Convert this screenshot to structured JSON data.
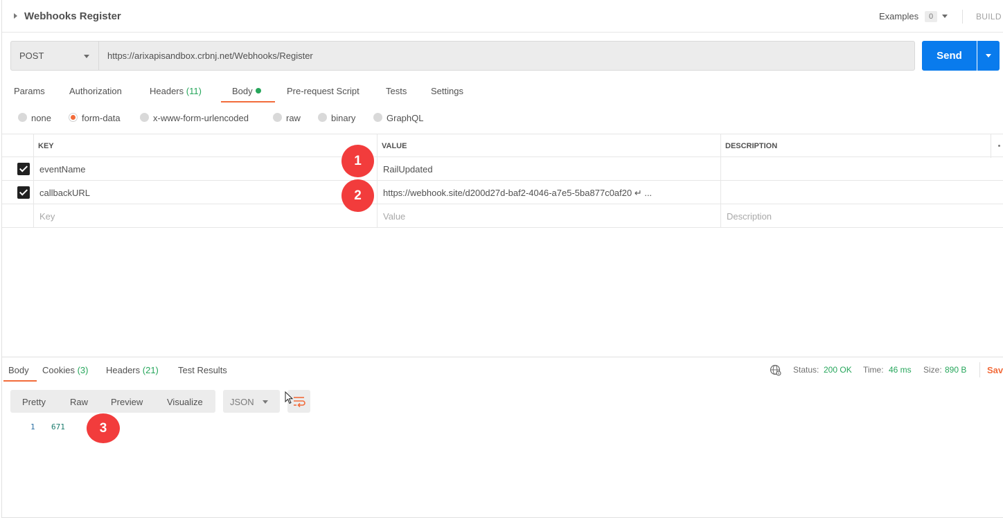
{
  "request": {
    "title": "Webhooks Register",
    "examples_label": "Examples",
    "examples_count": "0",
    "build_label": "BUILD",
    "method": "POST",
    "url": "https://arixapisandbox.crbnj.net/Webhooks/Register",
    "send_label": "Send"
  },
  "request_tabs": [
    {
      "label": "Params"
    },
    {
      "label": "Authorization"
    },
    {
      "label": "Headers",
      "count": "(11)"
    },
    {
      "label": "Body",
      "active": true
    },
    {
      "label": "Pre-request Script"
    },
    {
      "label": "Tests"
    },
    {
      "label": "Settings"
    }
  ],
  "body_types": [
    {
      "label": "none"
    },
    {
      "label": "form-data",
      "selected": true
    },
    {
      "label": "x-www-form-urlencoded"
    },
    {
      "label": "raw"
    },
    {
      "label": "binary"
    },
    {
      "label": "GraphQL"
    }
  ],
  "table": {
    "headers": [
      "KEY",
      "VALUE",
      "DESCRIPTION"
    ],
    "rows": [
      {
        "checked": true,
        "key": "eventName",
        "value": "RailUpdated",
        "description": ""
      },
      {
        "checked": true,
        "key": "callbackURL",
        "value": "https://webhook.site/d200d27d-baf2-4046-a7e5-5ba877c0af20 ↵ ...",
        "description": ""
      }
    ],
    "placeholders": {
      "key": "Key",
      "value": "Value",
      "description": "Description"
    }
  },
  "markers": [
    "1",
    "2",
    "3"
  ],
  "response": {
    "tabs": [
      {
        "label": "Body",
        "active": true
      },
      {
        "label": "Cookies",
        "count": "(3)"
      },
      {
        "label": "Headers",
        "count": "(21)"
      },
      {
        "label": "Test Results"
      }
    ],
    "status_label": "Status:",
    "status_value": "200 OK",
    "time_label": "Time:",
    "time_value": "46 ms",
    "size_label": "Size:",
    "size_value": "890 B",
    "save_label": "Sav",
    "view_modes": [
      "Pretty",
      "Raw",
      "Preview",
      "Visualize"
    ],
    "format": "JSON",
    "code_lines": [
      {
        "num": "1",
        "text": "671"
      }
    ]
  },
  "colors": {
    "accent": "#f26b3a",
    "send_blue": "#097bed",
    "success_green": "#26a65b",
    "marker_red": "#f23c3c"
  },
  "icons": [
    "caret-right-icon",
    "chevron-down-icon",
    "globe-icon",
    "wrap-lines-icon",
    "mouse-cursor-icon",
    "more-icon"
  ]
}
